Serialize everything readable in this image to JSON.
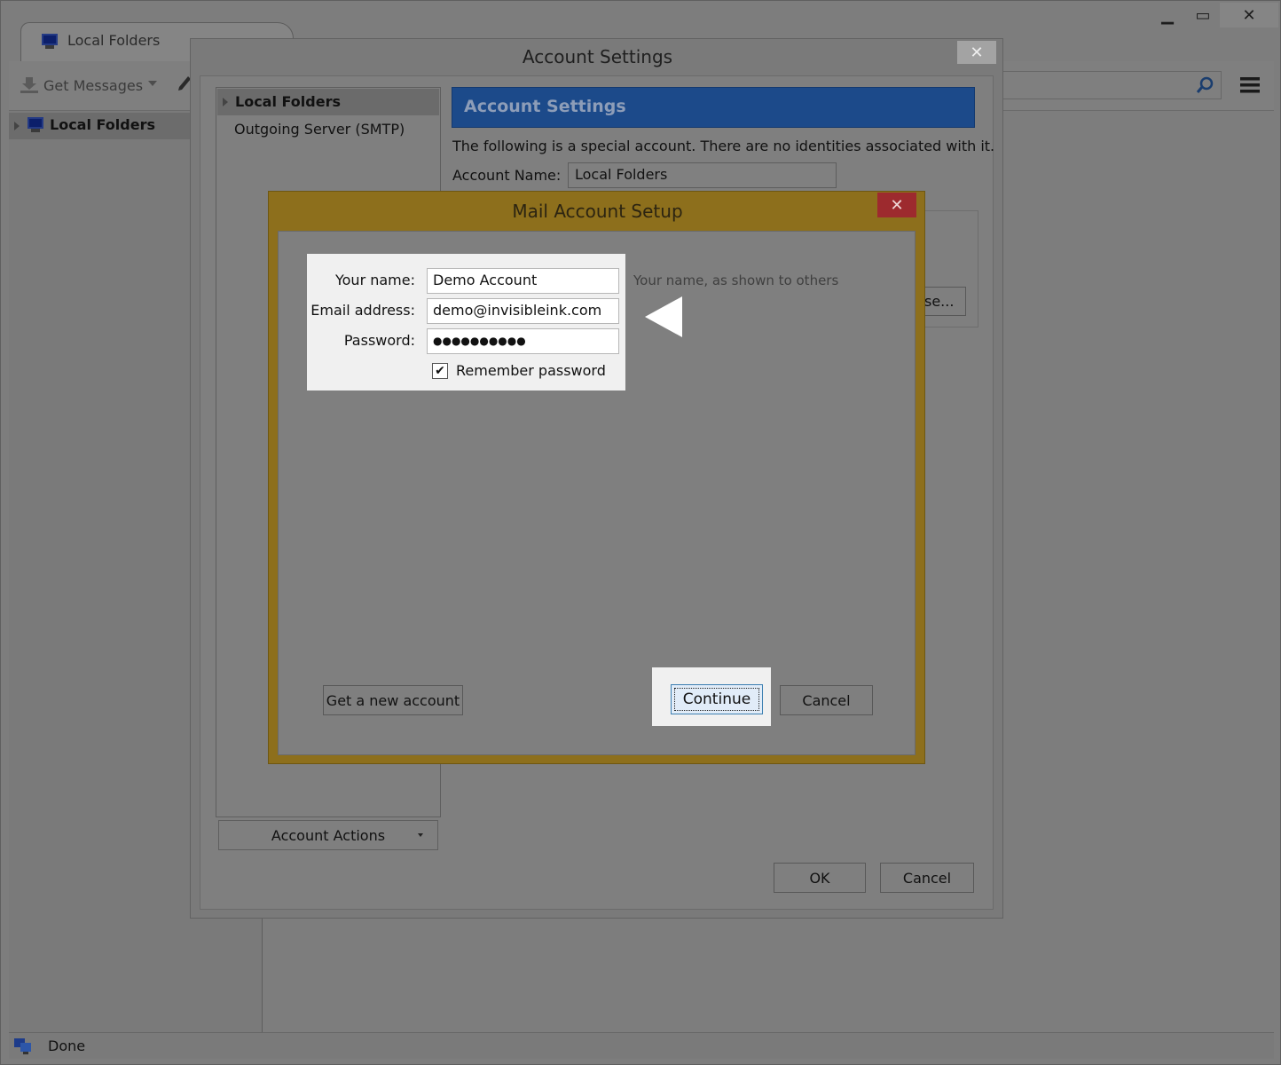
{
  "main_window": {
    "tab_title": "Local Folders",
    "toolbar": {
      "get_messages_label": "Get Messages"
    },
    "sidebar": {
      "folder_label": "Local Folders"
    },
    "status_text": "Done",
    "controls": {
      "minimize": "▁",
      "maximize": "▭",
      "close": "✕"
    }
  },
  "account_settings": {
    "title": "Account Settings",
    "close": "✕",
    "tree": {
      "items": [
        {
          "label": "Local Folders"
        },
        {
          "label": "Outgoing Server (SMTP)"
        }
      ]
    },
    "account_actions_label": "Account Actions",
    "banner_title": "Account Settings",
    "description": "The following is a special account. There are no identities associated with it.",
    "account_name_label": "Account Name:",
    "account_name_value": "Local Folders",
    "browse_fragment": "se...",
    "ok_label": "OK",
    "cancel_label": "Cancel"
  },
  "mail_setup": {
    "title": "Mail Account Setup",
    "close": "✕",
    "your_name_label": "Your name:",
    "your_name_value": "Demo Account",
    "your_name_hint": "Your name, as shown to others",
    "email_label": "Email address:",
    "email_value": "demo@invisibleink.com",
    "password_label": "Password:",
    "password_value": "●●●●●●●●●●",
    "remember_label": "Remember password",
    "remember_checked": true,
    "get_new_account_label": "Get a new account",
    "continue_label": "Continue",
    "cancel_label": "Cancel"
  }
}
